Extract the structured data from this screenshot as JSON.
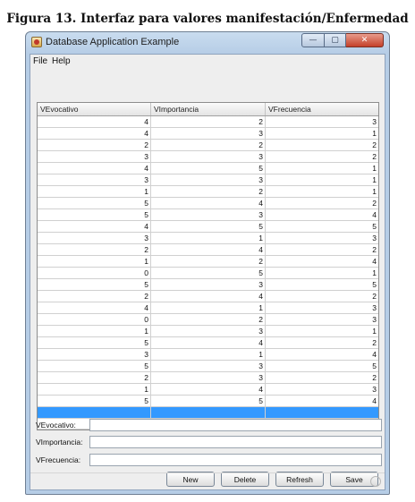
{
  "caption": "Figura 13. Interfaz para valores manifestación/Enfermedad",
  "window": {
    "title": "Database Application Example",
    "minimize_glyph": "—",
    "maximize_glyph": "▢",
    "close_glyph": "✕"
  },
  "menu": {
    "file": "File",
    "help": "Help"
  },
  "table": {
    "columns": [
      "VEvocativo",
      "VImportancia",
      "VFrecuencia"
    ],
    "rows": [
      [
        "4",
        "2",
        "3"
      ],
      [
        "4",
        "3",
        "1"
      ],
      [
        "2",
        "2",
        "2"
      ],
      [
        "3",
        "3",
        "2"
      ],
      [
        "4",
        "5",
        "1"
      ],
      [
        "3",
        "3",
        "1"
      ],
      [
        "1",
        "2",
        "1"
      ],
      [
        "5",
        "4",
        "2"
      ],
      [
        "5",
        "3",
        "4"
      ],
      [
        "4",
        "5",
        "5"
      ],
      [
        "3",
        "1",
        "3"
      ],
      [
        "2",
        "4",
        "2"
      ],
      [
        "1",
        "2",
        "4"
      ],
      [
        "0",
        "5",
        "1"
      ],
      [
        "5",
        "3",
        "5"
      ],
      [
        "2",
        "4",
        "2"
      ],
      [
        "4",
        "1",
        "3"
      ],
      [
        "0",
        "2",
        "3"
      ],
      [
        "1",
        "3",
        "1"
      ],
      [
        "5",
        "4",
        "2"
      ],
      [
        "3",
        "1",
        "4"
      ],
      [
        "5",
        "3",
        "5"
      ],
      [
        "2",
        "3",
        "2"
      ],
      [
        "1",
        "4",
        "3"
      ],
      [
        "5",
        "5",
        "4"
      ]
    ]
  },
  "form": {
    "evocativo_label": "VEvocativo:",
    "importancia_label": "VImportancia:",
    "frecuencia_label": "VFrecuencia:"
  },
  "buttons": {
    "new": "New",
    "delete": "Delete",
    "refresh": "Refresh",
    "save": "Save"
  },
  "colors": {
    "selection": "#3399ff",
    "title_gradient": "#b6cde6",
    "close_button": "#c4402a"
  },
  "icons": {
    "app": "java-cup-icon",
    "busy": "busy-indicator-icon"
  }
}
